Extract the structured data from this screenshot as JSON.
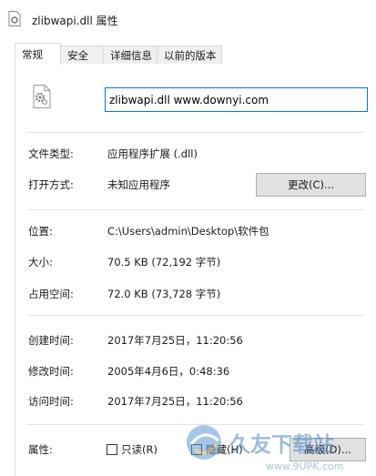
{
  "window": {
    "title": "zlibwapi.dll 属性"
  },
  "tabs": [
    {
      "label": "常规",
      "active": true
    },
    {
      "label": "安全",
      "active": false
    },
    {
      "label": "详细信息",
      "active": false
    },
    {
      "label": "以前的版本",
      "active": false
    }
  ],
  "general": {
    "filename": "zlibwapi.dll www.downyi.com",
    "file_type_label": "文件类型:",
    "file_type_value": "应用程序扩展 (.dll)",
    "opens_with_label": "打开方式:",
    "opens_with_value": "未知应用程序",
    "change_button": "更改(C)...",
    "location_label": "位置:",
    "location_value": "C:\\Users\\admin\\Desktop\\软件包",
    "size_label": "大小:",
    "size_value": "70.5 KB (72,192 字节)",
    "size_on_disk_label": "占用空间:",
    "size_on_disk_value": "72.0 KB (73,728 字节)",
    "created_label": "创建时间:",
    "created_value": "2017年7月25日，11:20:56",
    "modified_label": "修改时间:",
    "modified_value": "2005年4月6日，0:48:36",
    "accessed_label": "访问时间:",
    "accessed_value": "2017年7月25日，11:20:56",
    "attributes_label": "属性:",
    "readonly_label": "只读(R)",
    "readonly_checked": false,
    "hidden_label": "隐藏(H)",
    "hidden_checked": false,
    "advanced_button": "高级(D)..."
  },
  "watermark": {
    "brand": "久友下载站",
    "url": "www.9UPK.com"
  },
  "colors": {
    "focus_border": "#0078d7",
    "button_bg": "#e1e1e1",
    "button_border": "#adadad"
  }
}
